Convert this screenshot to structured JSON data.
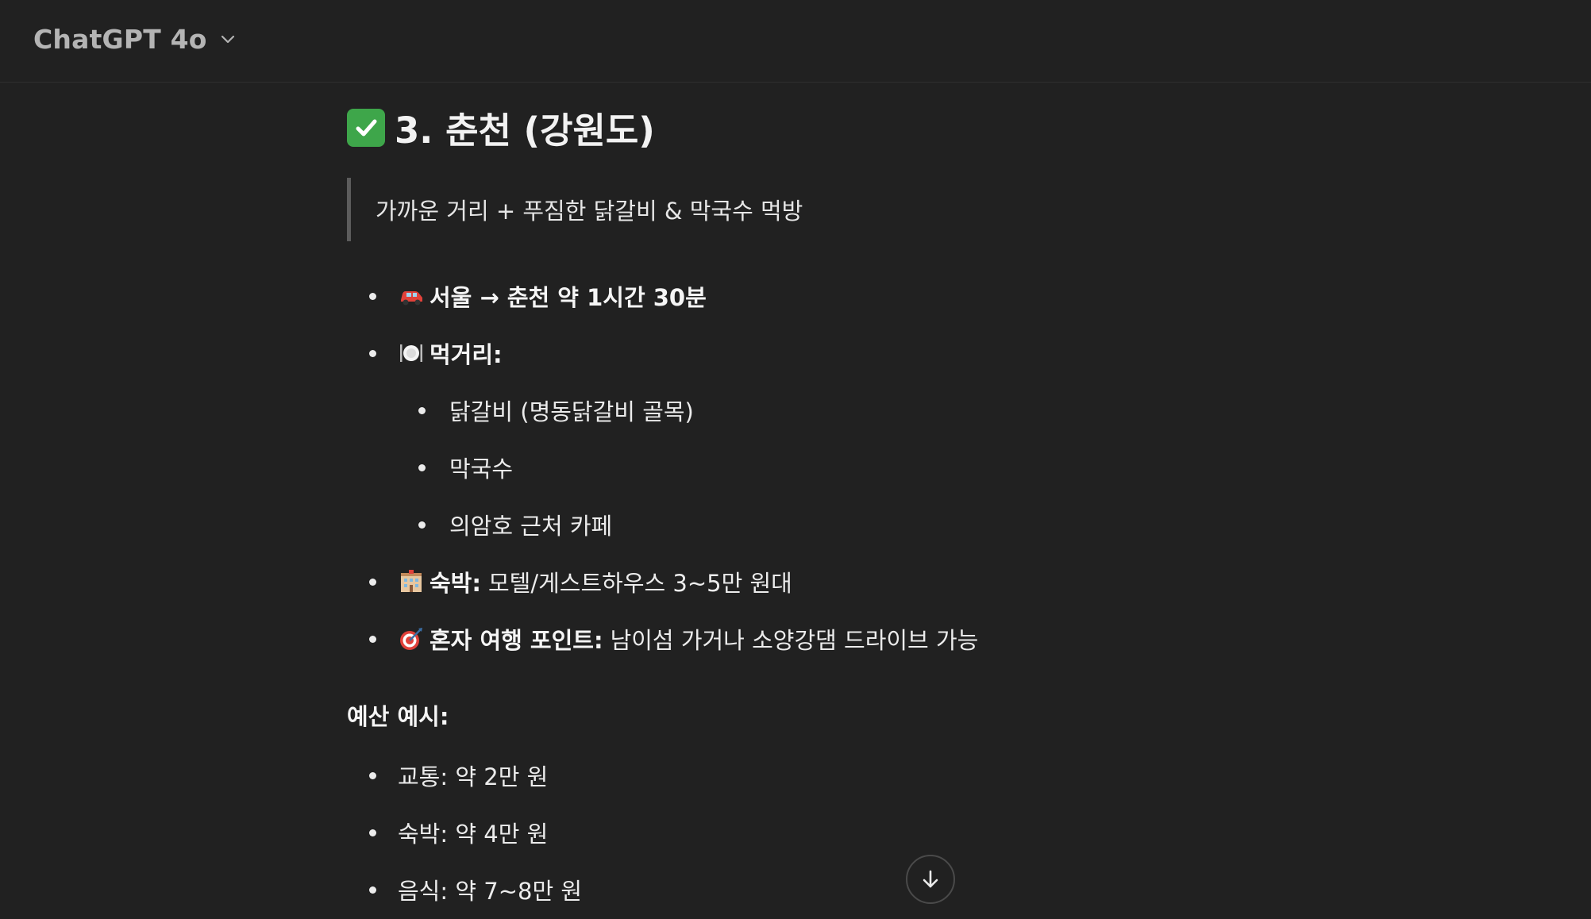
{
  "header": {
    "model_name": "ChatGPT 4o",
    "dropdown_icon": "chevron-down-icon"
  },
  "section": {
    "check_icon": "check-mark-button-icon",
    "title": "3. 춘천 (강원도)",
    "quote": "가까운 거리 + 푸짐한 닭갈비 & 막국수 먹방"
  },
  "items": {
    "travel": {
      "icon": "car-icon",
      "text": "서울 → 춘천 약 1시간 30분"
    },
    "food": {
      "icon": "plate-cutlery-icon",
      "label": "먹거리:",
      "subitems": [
        "닭갈비 (명동닭갈비 골목)",
        "막국수",
        "의암호 근처 카페"
      ]
    },
    "lodging": {
      "icon": "hotel-icon",
      "label": "숙박:",
      "text": "모텔/게스트하우스 3~5만 원대"
    },
    "solo": {
      "icon": "target-icon",
      "label": "혼자 여행 포인트:",
      "text": "남이섬 가거나 소양강댐 드라이브 가능"
    }
  },
  "budget": {
    "heading": "예산 예시:",
    "items": [
      "교통: 약 2만 원",
      "숙박: 약 4만 원",
      "음식: 약 7~8만 원"
    ]
  },
  "scroll_button": {
    "icon": "arrow-down-icon"
  },
  "colors": {
    "background": "#212121",
    "text": "#ececec",
    "muted": "#b4b4b4",
    "check_green": "#3ea64a"
  }
}
